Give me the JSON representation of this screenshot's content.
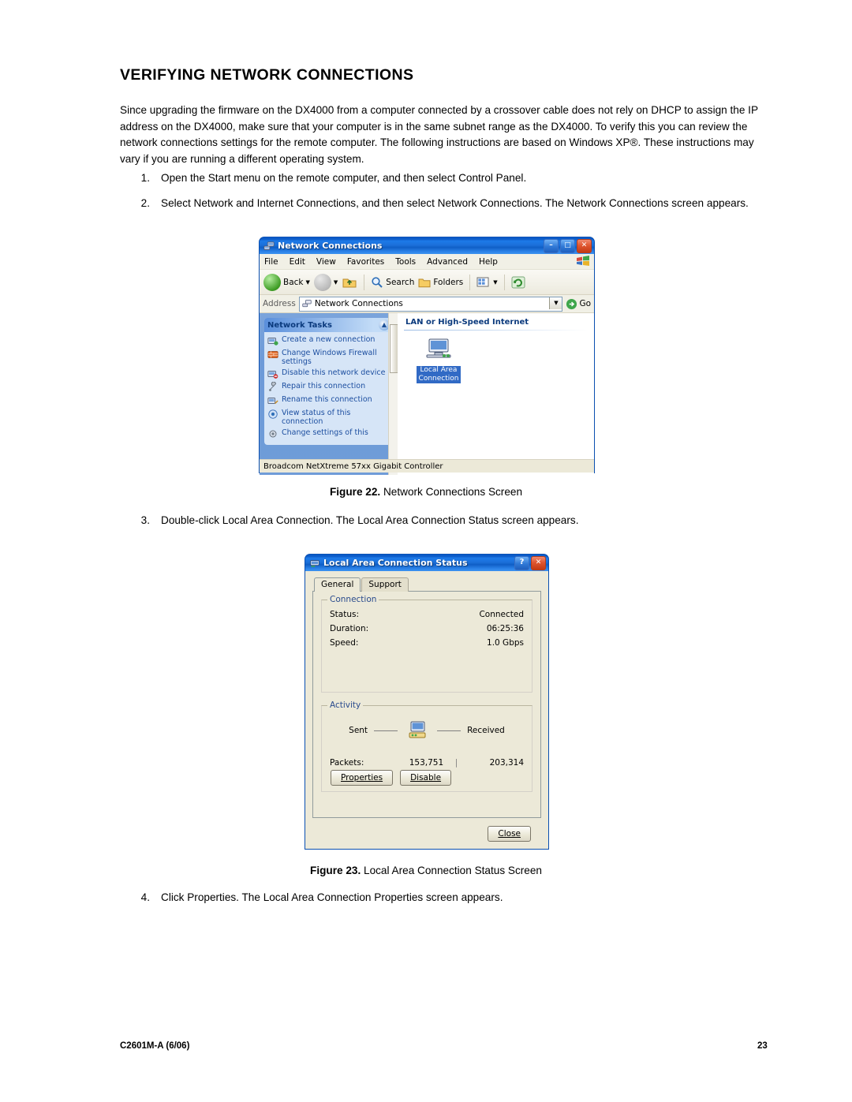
{
  "document": {
    "title": "VERIFYING NETWORK CONNECTIONS",
    "intro": "Since upgrading the firmware on the DX4000 from a computer connected by a crossover cable does not rely on DHCP to assign the IP address on the DX4000, make sure that your computer is in the same subnet range as the DX4000. To verify this you can review the network connections settings for the remote computer. The following instructions are based on Windows XP®. These instructions may vary if you are running a different operating system.",
    "steps": [
      {
        "num": "1.",
        "text": "Open the Start menu on the remote computer, and then select Control Panel."
      },
      {
        "num": "2.",
        "text": "Select Network and Internet Connections, and then select Network Connections. The Network Connections screen appears."
      },
      {
        "num": "3.",
        "text": "Double-click Local Area Connection. The Local Area Connection Status screen appears."
      },
      {
        "num": "4.",
        "text": "Click Properties. The Local Area Connection Properties screen appears."
      }
    ],
    "fig22_caption_label": "Figure 22.",
    "fig22_caption_text": "Network Connections Screen",
    "fig23_caption_label": "Figure 23.",
    "fig23_caption_text": "Local Area Connection Status Screen",
    "footer_left": "C2601M-A (6/06)",
    "footer_right": "23"
  },
  "fig22": {
    "window_title": "Network Connections",
    "menus": [
      "File",
      "Edit",
      "View",
      "Favorites",
      "Tools",
      "Advanced",
      "Help"
    ],
    "toolbar": {
      "back": "Back",
      "search": "Search",
      "folders": "Folders"
    },
    "address": {
      "label": "Address",
      "value": "Network Connections",
      "go": "Go"
    },
    "tasks_panel": {
      "title": "Network Tasks",
      "items": [
        "Create a new connection",
        "Change Windows Firewall settings",
        "Disable this network device",
        "Repair this connection",
        "Rename this connection",
        "View status of this connection",
        "Change settings of this"
      ]
    },
    "content": {
      "group_title": "LAN or High-Speed Internet",
      "connection_label": "Local Area Connection"
    },
    "statusbar": "Broadcom NetXtreme 57xx Gigabit Controller",
    "buttons": {
      "minimize": "–",
      "maximize": "□",
      "close": "✕"
    }
  },
  "fig23": {
    "window_title": "Local Area Connection Status",
    "buttons": {
      "help": "?",
      "close": "✕"
    },
    "tabs": [
      {
        "label": "General",
        "active": true
      },
      {
        "label": "Support",
        "active": false
      }
    ],
    "connection_group": {
      "title": "Connection",
      "rows": [
        {
          "key": "Status:",
          "value": "Connected"
        },
        {
          "key": "Duration:",
          "value": "06:25:36"
        },
        {
          "key": "Speed:",
          "value": "1.0 Gbps"
        }
      ]
    },
    "activity_group": {
      "title": "Activity",
      "sent_label": "Sent",
      "received_label": "Received",
      "packets_label": "Packets:",
      "packets_sent": "153,751",
      "packets_received": "203,314"
    },
    "actions": {
      "properties": "Properties",
      "disable": "Disable",
      "close": "Close"
    }
  }
}
